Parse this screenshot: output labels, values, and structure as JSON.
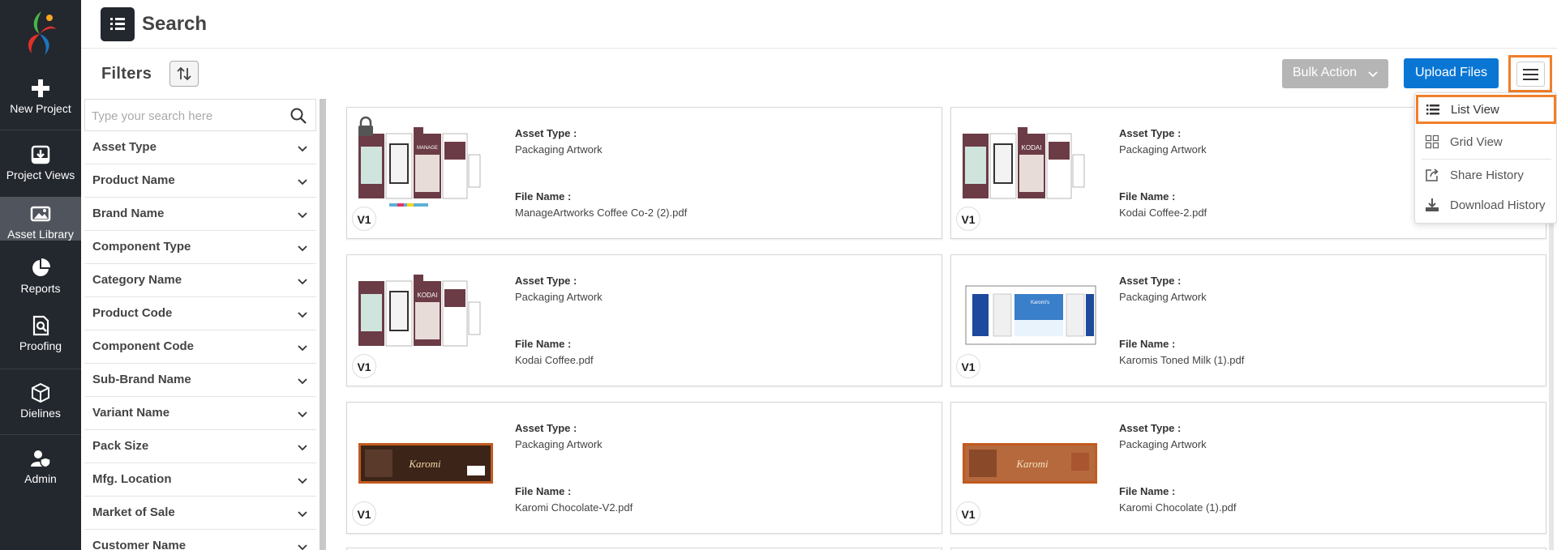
{
  "nav": {
    "items": [
      {
        "label": "New Project",
        "icon": "plus-icon"
      },
      {
        "label": "Project Views",
        "icon": "inbox-download-icon"
      },
      {
        "label": "Asset Library",
        "icon": "image-icon",
        "active": true
      },
      {
        "label": "Reports",
        "icon": "pie-chart-icon"
      },
      {
        "label": "Proofing",
        "icon": "document-search-icon"
      },
      {
        "label": "Dielines",
        "icon": "cube-icon"
      },
      {
        "label": "Admin",
        "icon": "user-shield-icon"
      }
    ]
  },
  "header": {
    "title": "Search"
  },
  "toolbar": {
    "filters_title": "Filters",
    "bulk_action": "Bulk Action",
    "upload_files": "Upload Files"
  },
  "search": {
    "placeholder": "Type your search here"
  },
  "filters": [
    "Asset Type",
    "Product Name",
    "Brand Name",
    "Component Type",
    "Category Name",
    "Product Code",
    "Component Code",
    "Sub-Brand Name",
    "Variant Name",
    "Pack Size",
    "Mfg. Location",
    "Market of Sale",
    "Customer Name"
  ],
  "asset_labels": {
    "asset_type": "Asset Type :",
    "file_name": "File Name :"
  },
  "assets": [
    {
      "version": "V1",
      "asset_type": "Packaging Artwork",
      "file_name": "ManageArtworks Coffee Co-2 (2).pdf",
      "locked": true,
      "thumb": "carton"
    },
    {
      "version": "V1",
      "asset_type": "Packaging Artwork",
      "file_name": "Kodai Coffee-2.pdf",
      "locked": false,
      "thumb": "carton"
    },
    {
      "version": "V1",
      "asset_type": "Packaging Artwork",
      "file_name": "Kodai Coffee.pdf",
      "locked": false,
      "thumb": "carton"
    },
    {
      "version": "V1",
      "asset_type": "Packaging Artwork",
      "file_name": "Karomis Toned Milk (1).pdf",
      "locked": false,
      "thumb": "milk"
    },
    {
      "version": "V1",
      "asset_type": "Packaging Artwork",
      "file_name": "Karomi Chocolate-V2.pdf",
      "locked": false,
      "thumb": "chocolate"
    },
    {
      "version": "V1",
      "asset_type": "Packaging Artwork",
      "file_name": "Karomi Chocolate (1).pdf",
      "locked": false,
      "thumb": "chocolate-light"
    }
  ],
  "view_menu": {
    "items": [
      {
        "label": "List View",
        "icon": "list-icon",
        "highlighted": true
      },
      {
        "label": "Grid View",
        "icon": "grid-icon"
      },
      {
        "label": "Share History",
        "icon": "share-icon"
      },
      {
        "label": "Download History",
        "icon": "download-icon"
      }
    ]
  },
  "colors": {
    "nav_bg": "#23272e",
    "nav_active": "#50555d",
    "primary": "#0a76d4",
    "disabled": "#b5b5b5",
    "highlight": "#f07f2a"
  }
}
